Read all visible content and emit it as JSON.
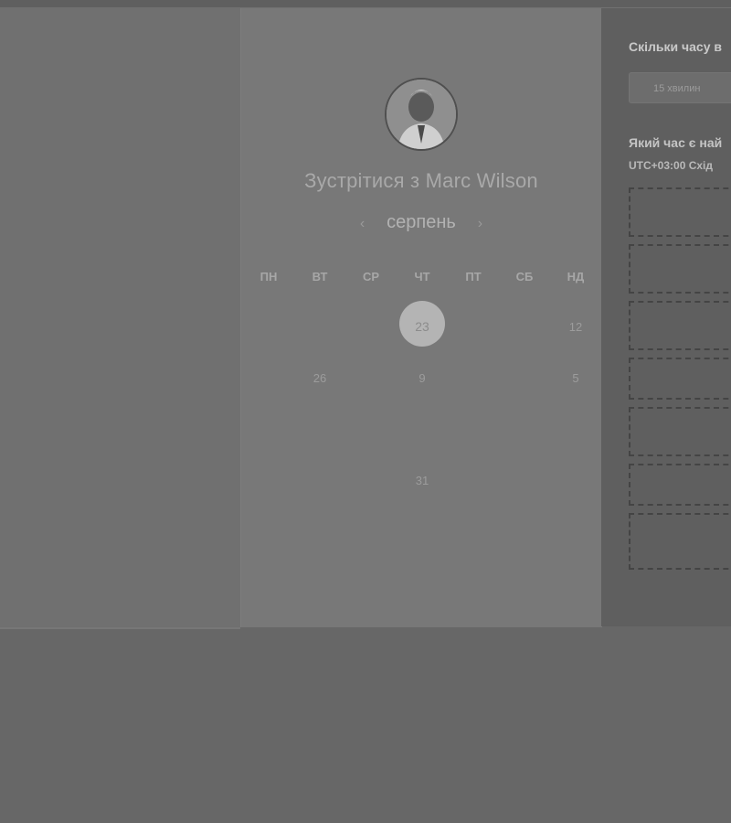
{
  "header": {
    "title": "Зустрітися з Marc Wilson"
  },
  "calendar": {
    "month": "серпень",
    "prev_icon": "chevron-left-icon",
    "next_icon": "chevron-right-icon",
    "weekdays": [
      "ПН",
      "ВТ",
      "СР",
      "ЧТ",
      "ПТ",
      "СБ",
      "НД"
    ],
    "weeks": [
      [
        "",
        "",
        "",
        "23",
        "",
        "",
        "12"
      ],
      [
        "",
        "26",
        "",
        "9",
        "",
        "",
        "5"
      ],
      [
        "",
        "",
        "",
        "",
        "",
        "",
        ""
      ],
      [
        "",
        "",
        "",
        "31",
        "",
        "",
        ""
      ],
      [
        "",
        "",
        "",
        "",
        "",
        "",
        ""
      ],
      [
        "",
        "",
        "",
        "",
        "",
        "",
        ""
      ]
    ],
    "selected_day": "23"
  },
  "sidebar": {
    "duration_label": "Скільки часу в",
    "duration_value": "15 хвилин",
    "timezone_question": "Який час є най",
    "timezone_value": "UTC+03:00 Схід"
  }
}
